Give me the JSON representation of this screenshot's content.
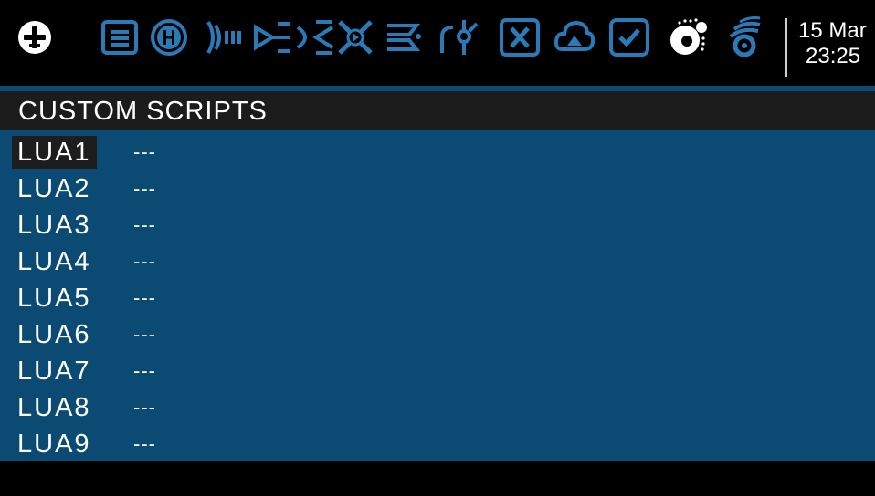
{
  "header": {
    "date": "15 Mar",
    "time": "23:25"
  },
  "icons": [
    "radio-settings-icon",
    "model-list-icon",
    "heli-icon",
    "inputs-icon",
    "mixer-icon",
    "outputs-icon",
    "curves-icon",
    "logical-switches-icon",
    "global-variables-icon",
    "special-functions-icon",
    "telemetry-icon",
    "checklist-icon",
    "custom-scripts-icon",
    "trainer-icon"
  ],
  "page": {
    "title": "CUSTOM SCRIPTS"
  },
  "scripts": [
    {
      "name": "LUA1",
      "value": "---"
    },
    {
      "name": "LUA2",
      "value": "---"
    },
    {
      "name": "LUA3",
      "value": "---"
    },
    {
      "name": "LUA4",
      "value": "---"
    },
    {
      "name": "LUA5",
      "value": "---"
    },
    {
      "name": "LUA6",
      "value": "---"
    },
    {
      "name": "LUA7",
      "value": "---"
    },
    {
      "name": "LUA8",
      "value": "---"
    },
    {
      "name": "LUA9",
      "value": "---"
    }
  ],
  "colors": {
    "background": "#000000",
    "accent": "#2a7ab8",
    "list_background": "#0b4a73",
    "title_background": "#1c1c1c",
    "selected_background": "#1d1d1d",
    "text": "#ffffff"
  }
}
